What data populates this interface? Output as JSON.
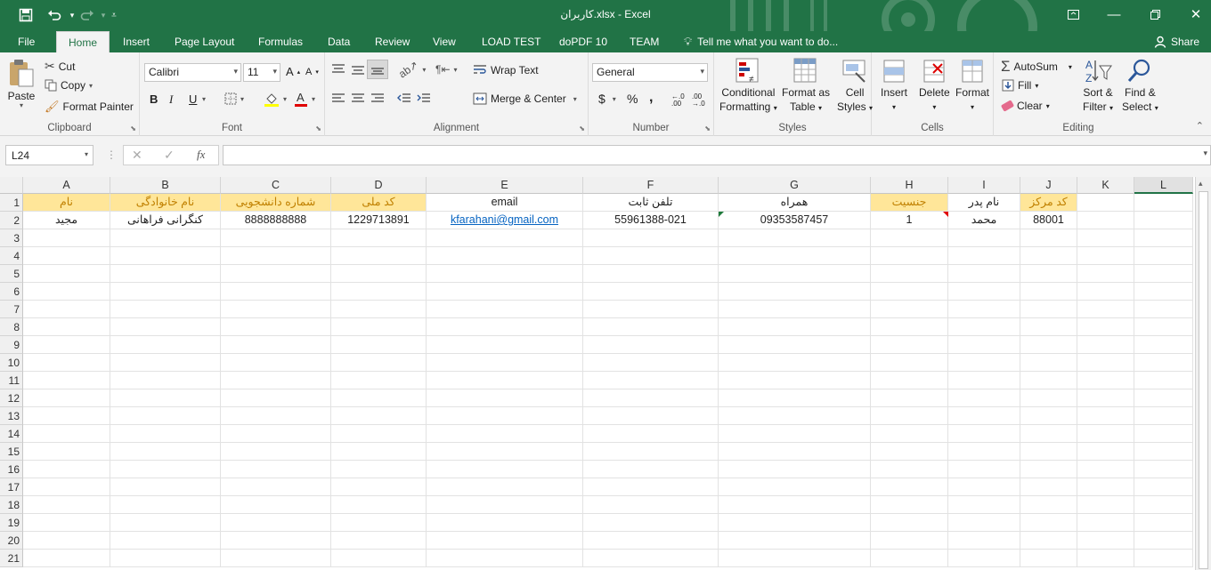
{
  "title": "کاربران.xlsx - Excel",
  "quick_access": {
    "save": "save-icon",
    "undo": "undo-icon",
    "redo": "redo-icon"
  },
  "tabs": [
    "File",
    "Home",
    "Insert",
    "Page Layout",
    "Formulas",
    "Data",
    "Review",
    "View",
    "LOAD TEST",
    "doPDF 10",
    "TEAM"
  ],
  "tell_me": "Tell me what you want to do...",
  "share": "Share",
  "clipboard": {
    "paste": "Paste",
    "cut": "Cut",
    "copy": "Copy",
    "format_painter": "Format Painter",
    "label": "Clipboard"
  },
  "font": {
    "name": "Calibri",
    "size": "11",
    "label": "Font",
    "bold": "B",
    "italic": "I",
    "underline": "U"
  },
  "alignment": {
    "wrap": "Wrap Text",
    "merge": "Merge & Center",
    "label": "Alignment"
  },
  "number": {
    "format": "General",
    "label": "Number",
    "currency": "$",
    "percent": "%",
    "comma": ","
  },
  "styles": {
    "conditional": "Conditional",
    "conditional2": "Formatting",
    "format_as": "Format as",
    "format_as2": "Table",
    "cell": "Cell",
    "cell2": "Styles",
    "label": "Styles"
  },
  "cells": {
    "insert": "Insert",
    "delete": "Delete",
    "format": "Format",
    "label": "Cells"
  },
  "editing": {
    "autosum": "AutoSum",
    "fill": "Fill",
    "clear": "Clear",
    "sort": "Sort &",
    "sort2": "Filter",
    "find": "Find &",
    "find2": "Select",
    "label": "Editing"
  },
  "name_box": "L24",
  "fx": "fx",
  "columns": [
    "A",
    "B",
    "C",
    "D",
    "E",
    "F",
    "G",
    "H",
    "I",
    "J",
    "K",
    "L"
  ],
  "row_numbers": [
    "1",
    "2",
    "3",
    "4",
    "5",
    "6",
    "7",
    "8",
    "9",
    "10",
    "11",
    "12",
    "13",
    "14",
    "15",
    "16",
    "17",
    "18",
    "19",
    "20",
    "21"
  ],
  "headers": [
    "نام",
    "نام خانوادگی",
    "شماره دانشجویی",
    "کد ملی",
    "email",
    "تلفن ثابت",
    "همراه",
    "جنسیت",
    "نام پدر",
    "کد مرکز"
  ],
  "row2": [
    "مجید",
    "کنگرانی فراهانی",
    "8888888888",
    "1229713891",
    "kfarahani@gmail.com",
    "55961388-021",
    "09353587457",
    "1",
    "محمد",
    "88001"
  ],
  "colors": {
    "accent": "#217346",
    "header_fill": "#ffe699",
    "link": "#0563c1"
  }
}
